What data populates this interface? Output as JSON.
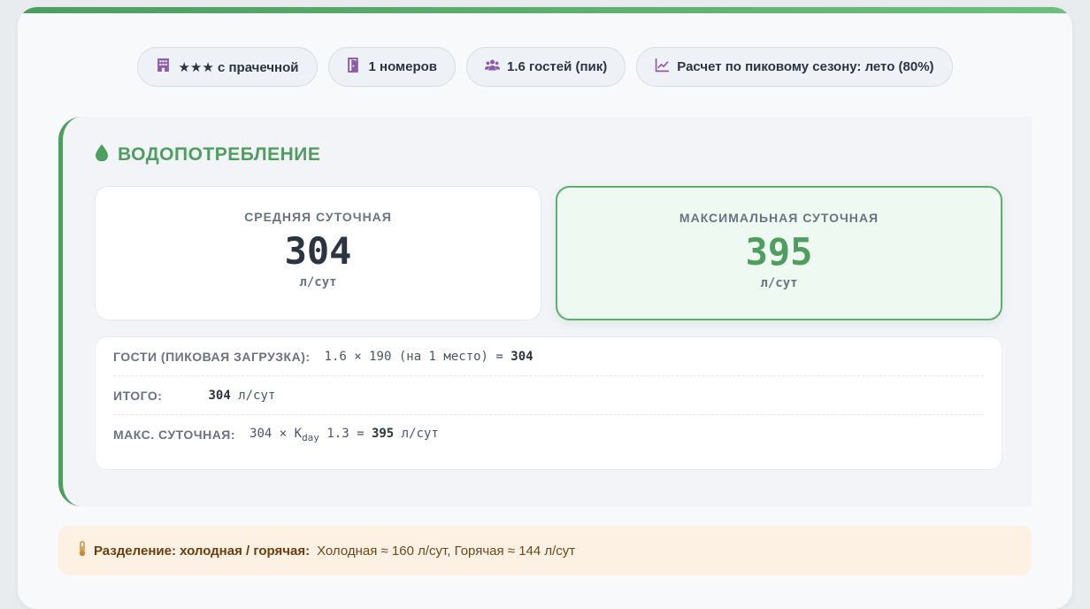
{
  "chips": [
    {
      "icon": "hotel-icon",
      "label": "★★★ с прачечной"
    },
    {
      "icon": "door-icon",
      "label": "1 номеров"
    },
    {
      "icon": "users-icon",
      "label": "1.6 гостей (пик)"
    },
    {
      "icon": "chart-icon",
      "label": "Расчет по пиковому сезону: лето (80%)"
    }
  ],
  "water": {
    "title": "ВОДОПОТРЕБЛЕНИЕ",
    "avg": {
      "label": "СРЕДНЯЯ СУТОЧНАЯ",
      "value": "304",
      "unit": "л/сут"
    },
    "max": {
      "label": "МАКСИМАЛЬНАЯ СУТОЧНАЯ",
      "value": "395",
      "unit": "л/сут"
    },
    "calc": {
      "guests": {
        "label": "ГОСТИ (ПИКОВАЯ ЗАГРУЗКА):",
        "formula": "1.6 × 190 (на 1 место) = ",
        "result": "304"
      },
      "total": {
        "label": "ИТОГО:",
        "value": "304",
        "unit": " л/сут"
      },
      "max": {
        "label": "МАКС. СУТОЧНАЯ:",
        "prefix": "304 × K",
        "sub": "day",
        "mid": " 1.3 = ",
        "value": "395",
        "unit": " л/сут"
      }
    }
  },
  "split": {
    "label": "Разделение: холодная / горячая:",
    "text": "Холодная ≈ 160 л/сут, Горячая ≈ 144 л/сут"
  },
  "colors": {
    "accent": "#4e9e60",
    "chip_icon": "#8b5ca8",
    "split_bg": "#fdf1e4"
  }
}
